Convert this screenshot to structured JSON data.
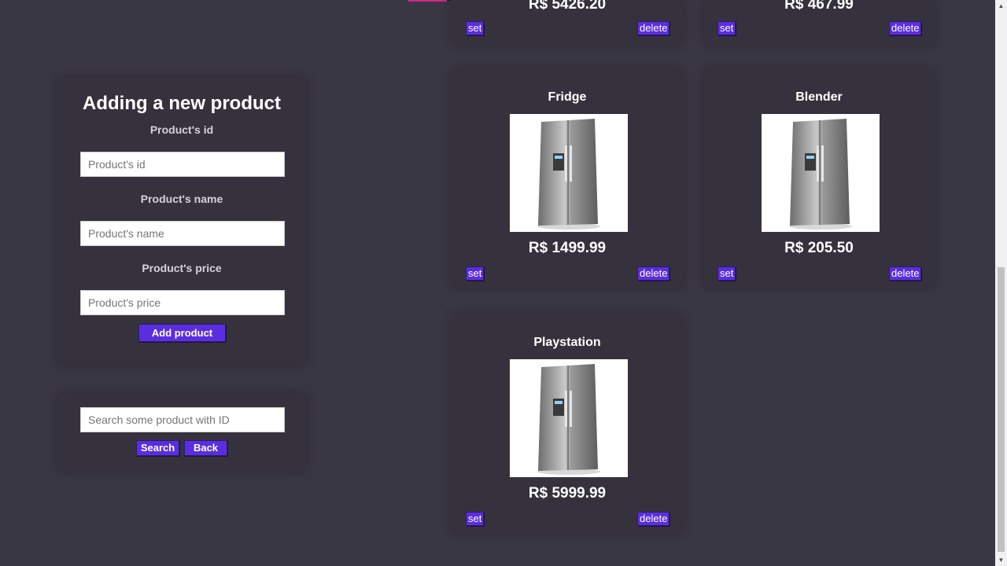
{
  "form": {
    "title": "Adding a new product",
    "id_label": "Product's id",
    "id_placeholder": "Product's id",
    "name_label": "Product's name",
    "name_placeholder": "Product's name",
    "price_label": "Product's price",
    "price_placeholder": "Product's price",
    "add_button": "Add product"
  },
  "search": {
    "placeholder": "Search some product with ID",
    "search_button": "Search",
    "back_button": "Back"
  },
  "products_top_partial": [
    {
      "price": "R$ 5426.20",
      "set_label": "set",
      "delete_label": "delete"
    },
    {
      "price": "R$ 467.99",
      "set_label": "set",
      "delete_label": "delete"
    }
  ],
  "products": [
    {
      "name": "Fridge",
      "price": "R$ 1499.99",
      "set_label": "set",
      "delete_label": "delete"
    },
    {
      "name": "Blender",
      "price": "R$ 205.50",
      "set_label": "set",
      "delete_label": "delete"
    },
    {
      "name": "Playstation",
      "price": "R$ 5999.99",
      "set_label": "set",
      "delete_label": "delete"
    }
  ],
  "colors": {
    "background": "#3a3744",
    "panel": "#35323d",
    "accent": "#5a2ee0"
  },
  "icons": {
    "product_image": "fridge-image",
    "scroll_up": "arrow-up-icon",
    "scroll_down": "arrow-down-icon"
  }
}
